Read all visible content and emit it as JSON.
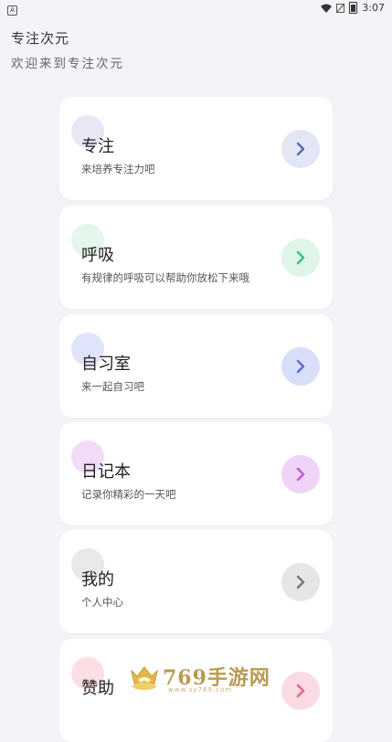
{
  "status_bar": {
    "time": "3:07",
    "left_icon": "A"
  },
  "header": {
    "title": "专注次元",
    "subtitle": "欢迎来到专注次元"
  },
  "cards": [
    {
      "title": "专注",
      "desc": "来培养专注力吧",
      "blob": "#e7e8f4",
      "arrow_bg": "#e3e6f5",
      "arrow_fg": "#5b6aa8"
    },
    {
      "title": "呼吸",
      "desc": "有规律的呼吸可以帮助你放松下来哦",
      "blob": "#e5f6ec",
      "arrow_bg": "#def5e8",
      "arrow_fg": "#3fbf78"
    },
    {
      "title": "自习室",
      "desc": "来一起自习吧",
      "blob": "#dfe3fb",
      "arrow_bg": "#d9def9",
      "arrow_fg": "#5a6ad6"
    },
    {
      "title": "日记本",
      "desc": "记录你精彩的一天吧",
      "blob": "#f1dcf8",
      "arrow_bg": "#efd4f8",
      "arrow_fg": "#b95bd9"
    },
    {
      "title": "我的",
      "desc": "个人中心",
      "blob": "#e9e9ec",
      "arrow_bg": "#e6e6e8",
      "arrow_fg": "#777777"
    },
    {
      "title": "赞助",
      "desc": "",
      "blob": "#fbdfe5",
      "arrow_bg": "#fbdbe3",
      "arrow_fg": "#e06a86"
    }
  ],
  "watermark": {
    "text": "769手游网",
    "url": "www.sy769.com"
  }
}
